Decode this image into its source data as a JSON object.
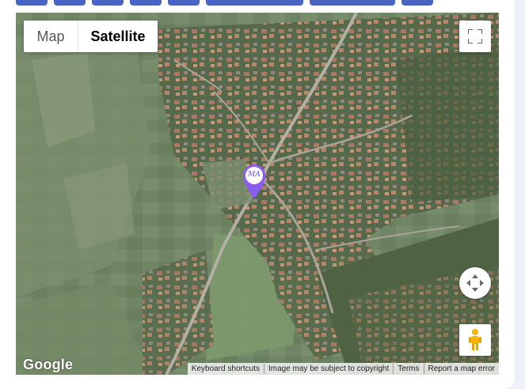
{
  "tabs_partial": [
    {
      "name": "tab-1"
    },
    {
      "name": "tab-2"
    },
    {
      "name": "tab-3"
    },
    {
      "name": "tab-4"
    },
    {
      "name": "tab-5"
    },
    {
      "name": "tab-6"
    },
    {
      "name": "tab-7"
    },
    {
      "name": "tab-8"
    }
  ],
  "map": {
    "type_control": {
      "map_label": "Map",
      "satellite_label": "Satellite",
      "selected": "Satellite"
    },
    "marker": {
      "monogram": "MA",
      "color": "#8a5cf0"
    },
    "logo": "Google",
    "attribution": {
      "shortcuts": "Keyboard shortcuts",
      "copyright": "Image may be subject to copyright",
      "terms": "Terms",
      "report": "Report a map error"
    },
    "controls": {
      "fullscreen": "fullscreen-icon",
      "pan": "pan-arrows-icon",
      "street_view": "pegman-icon"
    }
  },
  "colors": {
    "tab_accent": "#4a64c6",
    "page_background": "#eef2f8"
  }
}
